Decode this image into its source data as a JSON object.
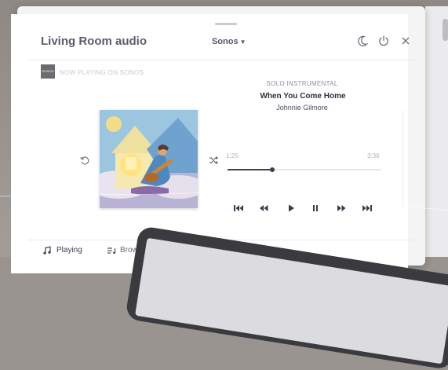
{
  "header": {
    "title": "Living Room audio",
    "source": "Sonos",
    "icons": [
      "moon-icon",
      "power-icon",
      "close-icon"
    ]
  },
  "now_playing": {
    "logo_text": "SONOS",
    "label": "NOW PLAYING ON SONOS",
    "genre": "SOLO INSTRUMENTAL",
    "song": "When You Come Home",
    "artist": "Johnnie Gilmore",
    "elapsed": "1:25",
    "total": "3:36",
    "progress": 0.29
  },
  "controls": [
    "skip-to-start-icon",
    "rewind-icon",
    "play-icon",
    "pause-icon",
    "fast-forward-icon",
    "skip-to-end-icon"
  ],
  "tabs": [
    {
      "label": "Playing",
      "icon": "music-note-icon"
    },
    {
      "label": "Browse",
      "icon": "browse-icon"
    }
  ],
  "colors": {
    "background": "#9a9490",
    "card": "#ffffff",
    "accent": "#3d3f52"
  }
}
